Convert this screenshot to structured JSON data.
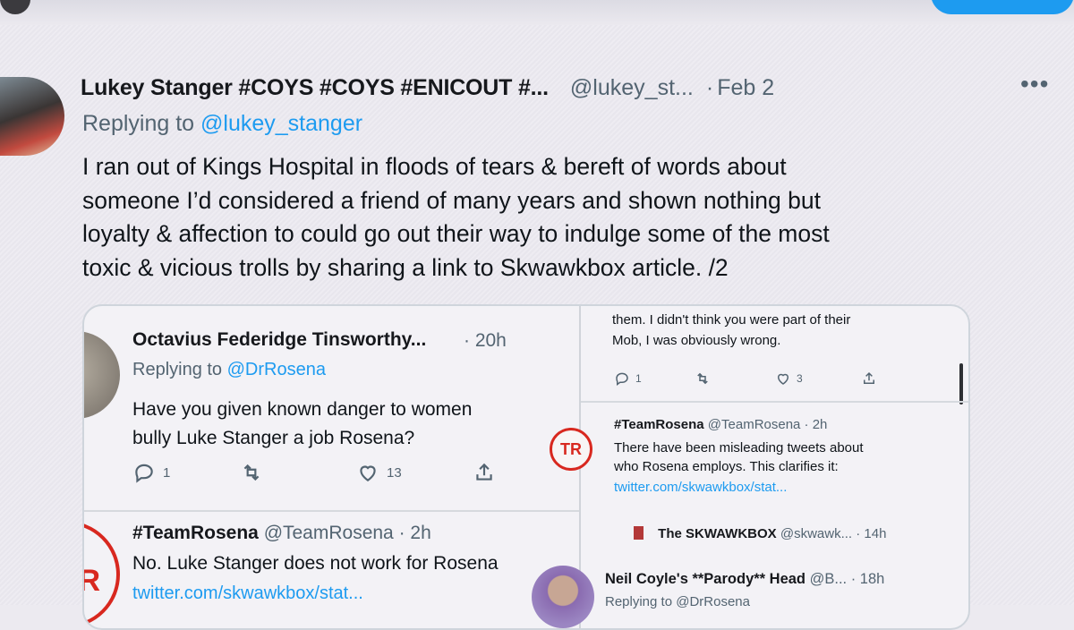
{
  "main_tweet": {
    "name": "Lukey Stanger #COYS #COYS #ENICOUT #...",
    "handle": "@lukey_st...",
    "separator": "·",
    "date": "Feb 2",
    "more_label": "•••",
    "replying_to_prefix": "Replying to",
    "replying_to_handle": "@lukey_stanger",
    "lines": [
      "I ran out of Kings Hospital in floods of tears & bereft of words about",
      "someone I’d considered a friend of many years and shown nothing but",
      "loyalty & affection to could go out their way to indulge some of the most",
      "toxic & vicious trolls by sharing a link to Skwawkbox article. /2"
    ]
  },
  "embedded": {
    "left": {
      "tweet1": {
        "name": "Octavius Federidge Tinsworthy...",
        "time": "· 20h",
        "replying_to_prefix": "Replying to",
        "replying_to_handle": "@DrRosena",
        "lines": [
          "Have you given known danger to women",
          "bully Luke Stanger a job Rosena?"
        ],
        "reply_count": "1",
        "retweet_count": "",
        "like_count": "13"
      },
      "tweet2": {
        "name": "#TeamRosena",
        "handle": "@TeamRosena · 2h",
        "text": "No. Luke Stanger does not work for Rosena",
        "link": "twitter.com/skwawkbox/stat...",
        "avatar_initials": "R"
      }
    },
    "right": {
      "top_lines": [
        "them. I didn't think you were part of their",
        "Mob, I was obviously wrong."
      ],
      "top_actions": {
        "reply": "1",
        "retweet": "",
        "like": "3"
      },
      "tweet2": {
        "avatar_initials": "TR",
        "name": "#TeamRosena",
        "handle": "@TeamRosena · 2h",
        "lines": [
          "There have been misleading tweets about",
          "who Rosena employs. This clarifies it:"
        ],
        "link": "twitter.com/skwawkbox/stat..."
      },
      "tweet3": {
        "name": "The SKWAWKBOX",
        "handle": "@skwawk... · 14h"
      },
      "tweet4": {
        "name": "Neil Coyle's **Parody** Head",
        "handle": "@B... · 18h",
        "replying": "Replying to @DrRosena"
      }
    }
  }
}
